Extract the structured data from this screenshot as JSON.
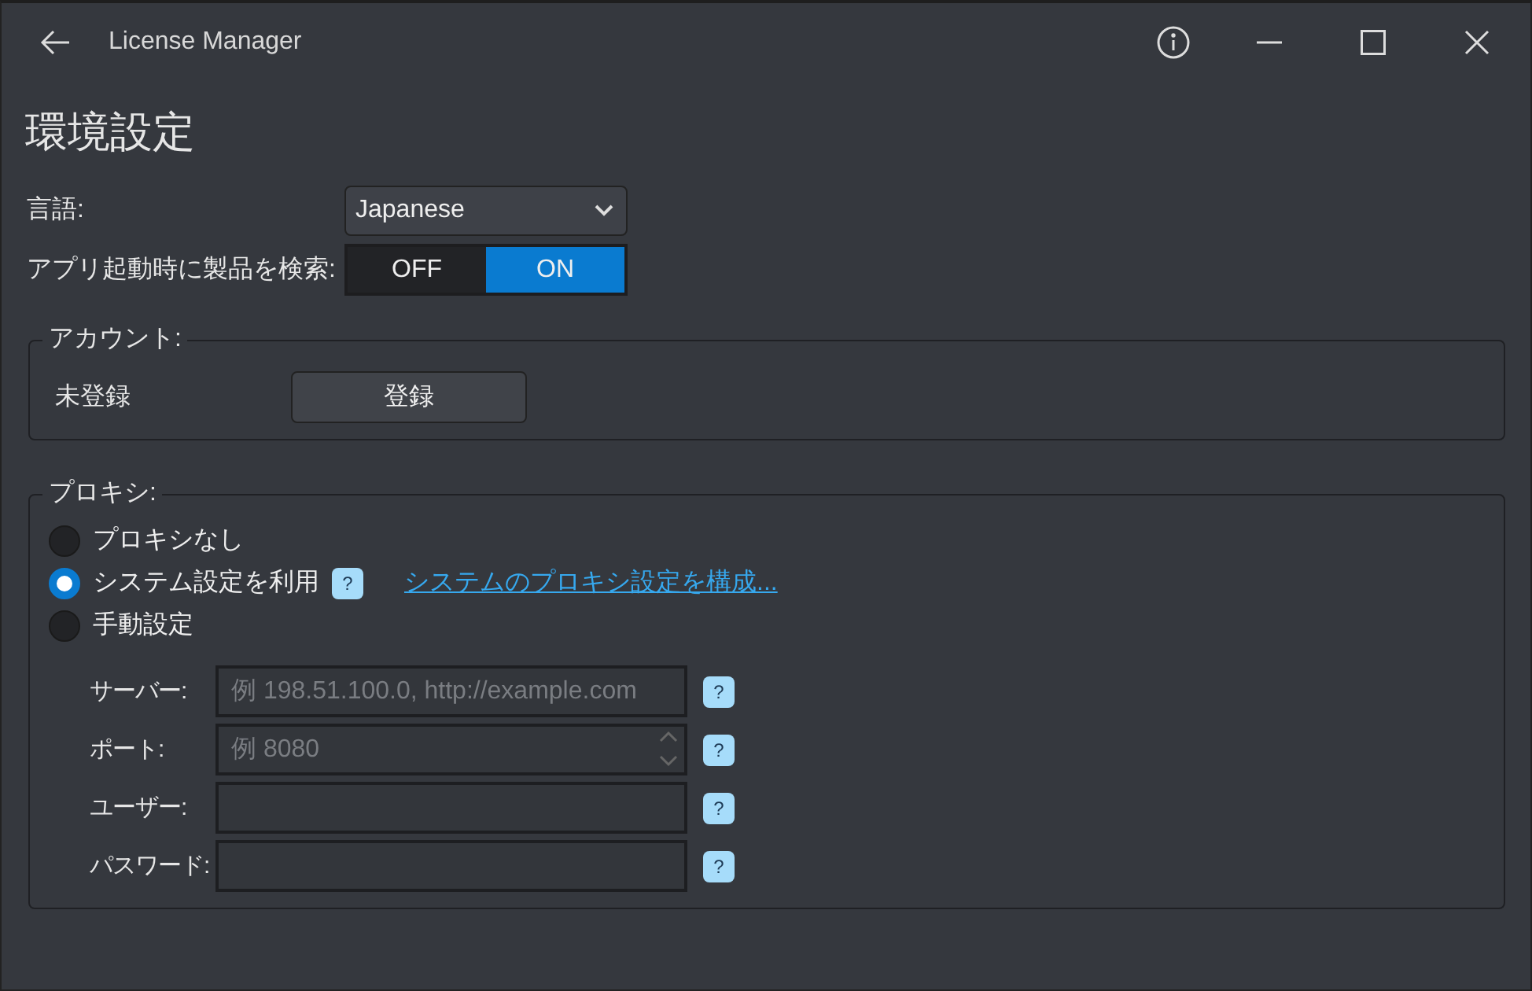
{
  "window": {
    "title": "License Manager"
  },
  "heading": "環境設定",
  "language": {
    "label": "言語:",
    "value": "Japanese"
  },
  "startup_search": {
    "label": "アプリ起動時に製品を検索:",
    "options": [
      {
        "label": "OFF",
        "selected": false
      },
      {
        "label": "ON",
        "selected": true
      }
    ]
  },
  "account": {
    "title": "アカウント:",
    "status": "未登録",
    "button": "登録"
  },
  "proxy": {
    "title": "プロキシ:",
    "options": [
      {
        "label": "プロキシなし",
        "selected": false
      },
      {
        "label": "システム設定を利用",
        "selected": true,
        "help": "?",
        "link": "システムのプロキシ設定を構成..."
      },
      {
        "label": "手動設定",
        "selected": false
      }
    ],
    "fields": [
      {
        "label": "サーバー:",
        "kind": "text",
        "placeholder": "例 198.51.100.0, http://example.com",
        "help": "?"
      },
      {
        "label": "ポート:",
        "kind": "number",
        "placeholder": "例 8080",
        "help": "?"
      },
      {
        "label": "ユーザー:",
        "kind": "text",
        "help": "?"
      },
      {
        "label": "パスワード:",
        "kind": "password",
        "help": "?"
      }
    ]
  }
}
